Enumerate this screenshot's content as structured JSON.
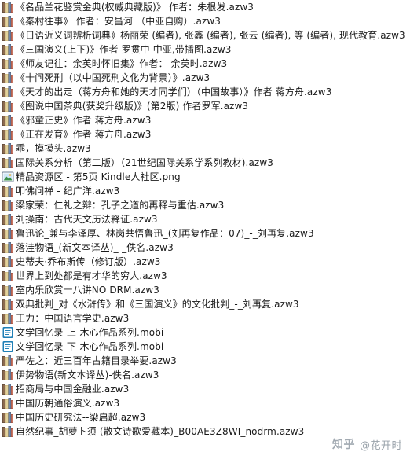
{
  "files": [
    {
      "name": "《名品兰花鉴赏金典(权威典藏版)》 作者：朱根发.azw3",
      "icon": "azw3-book-icon"
    },
    {
      "name": "《秦村往事》 作者：安昌河 （中亚自购）.azw3",
      "icon": "azw3-book-icon"
    },
    {
      "name": "《日语近义词辨析词典》杨丽荣 (编者), 张鑫 (编者), 张云 (编者), 等 (编者), 现代教育.azw3",
      "icon": "azw3-book-icon"
    },
    {
      "name": "《三国演义(上下)》作者 罗贯中 中亚,带插图.azw3",
      "icon": "azw3-book-icon"
    },
    {
      "name": "《师友记往：余英时怀旧集》作者： 余英时.azw3",
      "icon": "azw3-book-icon"
    },
    {
      "name": "《十问死刑（以中国死刑文化为背景）》.azw3",
      "icon": "azw3-book-icon"
    },
    {
      "name": "《天才的出走（蒋方舟和她的天才同学们）（中国故事）》作者 蒋方舟.azw3",
      "icon": "azw3-book-icon"
    },
    {
      "name": "《图说中国茶典(获奖升级版)》(第2版) 作者罗军.azw3",
      "icon": "azw3-book-icon"
    },
    {
      "name": "《邪童正史》作者 蒋方舟.azw3",
      "icon": "azw3-book-icon"
    },
    {
      "name": "《正在发育》作者 蒋方舟.azw3",
      "icon": "azw3-book-icon"
    },
    {
      "name": "乖，摸摸头.azw3",
      "icon": "azw3-book-icon"
    },
    {
      "name": "国际关系分析（第二版）（21世纪国际关系学系列教材).azw3",
      "icon": "azw3-book-icon"
    },
    {
      "name": "精品资源区 - 第5页 Kindle人社区.png",
      "icon": "png-image-icon"
    },
    {
      "name": "叩佛问禅 - 纪广洋.azw3",
      "icon": "azw3-book-icon"
    },
    {
      "name": "梁家荣：仁礼之辩：孔子之道的再释与重估.azw3",
      "icon": "azw3-book-icon"
    },
    {
      "name": "刘操南：古代天文历法释证.azw3",
      "icon": "azw3-book-icon"
    },
    {
      "name": "鲁迅论_兼与李泽厚、林岗共悟鲁迅_(刘再复作品：07)_-_刘再复.azw3",
      "icon": "azw3-book-icon"
    },
    {
      "name": "落洼物语_(新文本译丛)_-_佚名.azw3",
      "icon": "azw3-book-icon"
    },
    {
      "name": "史蒂夫·乔布斯传（修订版）.azw3",
      "icon": "azw3-book-icon"
    },
    {
      "name": "世界上到处都是有才华的穷人.azw3",
      "icon": "azw3-book-icon"
    },
    {
      "name": "室内乐欣赏十八讲NO DRM.azw3",
      "icon": "azw3-book-icon"
    },
    {
      "name": "双典批判_对《水浒传》和《三国演义》的文化批判_-_刘再复.azw3",
      "icon": "azw3-book-icon"
    },
    {
      "name": "王力：中国语言学史.azw3",
      "icon": "azw3-book-icon"
    },
    {
      "name": "文学回忆录-上-木心作品系列.mobi",
      "icon": "mobi-book-icon"
    },
    {
      "name": "文学回忆录-下-木心作品系列.mobi",
      "icon": "mobi-book-icon"
    },
    {
      "name": "严佐之：近三百年古籍目录举要.azw3",
      "icon": "azw3-book-icon"
    },
    {
      "name": "伊势物语(新文本译丛)-佚名.azw3",
      "icon": "azw3-book-icon"
    },
    {
      "name": "招商局与中国金融业.azw3",
      "icon": "azw3-book-icon"
    },
    {
      "name": "中国历朝通俗演义.azw3",
      "icon": "azw3-book-icon"
    },
    {
      "name": "中国历史研究法--梁启超.azw3",
      "icon": "azw3-book-icon"
    },
    {
      "name": "自然纪事_胡萝卜须 (散文诗歌爱藏本)_B00AE3Z8WI_nodrm.azw3",
      "icon": "azw3-book-icon"
    }
  ],
  "watermark": {
    "site": "知乎",
    "user": "@花开时"
  }
}
